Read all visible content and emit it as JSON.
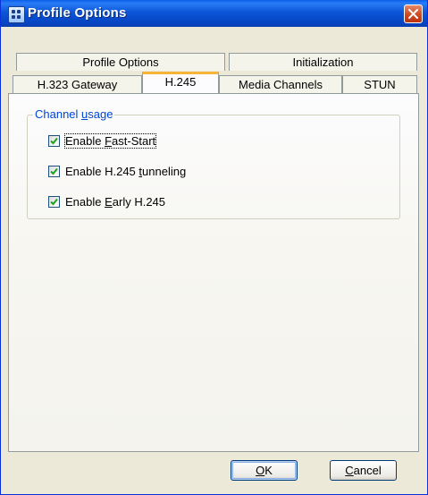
{
  "window": {
    "title": "Profile Options"
  },
  "tabs_back": [
    "Profile Options",
    "Initialization"
  ],
  "tabs_front": [
    "H.323 Gateway",
    "H.245",
    "Media Channels",
    "STUN"
  ],
  "active_tab": "H.245",
  "group": {
    "title_pre": "Channel ",
    "title_accel": "u",
    "title_post": "sage",
    "options": [
      {
        "pre": "Enable ",
        "accel": "F",
        "post": "ast-Start",
        "checked": true
      },
      {
        "pre": "Enable H.245 ",
        "accel": "t",
        "post": "unneling",
        "checked": true
      },
      {
        "pre": "Enable ",
        "accel": "E",
        "post": "arly H.245",
        "checked": true
      }
    ]
  },
  "buttons": {
    "ok": {
      "accel": "O",
      "rest": "K"
    },
    "cancel": {
      "accel": "C",
      "rest": "ancel"
    }
  },
  "colors": {
    "title_bar": "#0a5fe8",
    "close_button": "#d0491f",
    "active_tab_accent": "#f8b33a",
    "group_title": "#0046d5"
  }
}
